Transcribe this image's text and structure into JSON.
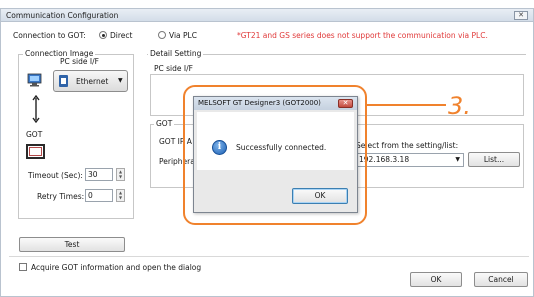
{
  "window": {
    "title": "Communication Configuration",
    "close_label": "✕"
  },
  "connection": {
    "label": "Connection to GOT:",
    "direct_label": "Direct",
    "via_plc_label": "Via PLC",
    "selected": "Direct",
    "warning": "*GT21 and GS series does not support the communication via PLC.",
    "warning_color": "#e03a3a"
  },
  "connection_image": {
    "title": "Connection Image",
    "pc_side_if": "PC side I/F",
    "ethernet_label": "Ethernet",
    "got_label": "GOT"
  },
  "timeout": {
    "label": "Timeout (Sec):",
    "value": "30"
  },
  "retry": {
    "label": "Retry Times:",
    "value": "0"
  },
  "detail": {
    "title": "Detail Setting",
    "pc_side_if": "PC side I/F",
    "got_section": "GOT",
    "got_ip_label": "GOT IP A",
    "peripheral_label": "Peripheral",
    "select_label": "Select from the setting/list:",
    "ip_value": "192.168.3.18",
    "list_button": "List..."
  },
  "test_button": "Test",
  "acquire_checkbox": "Acquire GOT information and open the dialog",
  "ok_button": "OK",
  "cancel_button": "Cancel",
  "dialog": {
    "title": "MELSOFT GT Designer3 (GOT2000)",
    "close_label": "✕",
    "message": "Successfully connected.",
    "ok_button": "OK",
    "icon": "info-icon"
  },
  "callout": {
    "number": "3.",
    "color": "#f0822d"
  }
}
